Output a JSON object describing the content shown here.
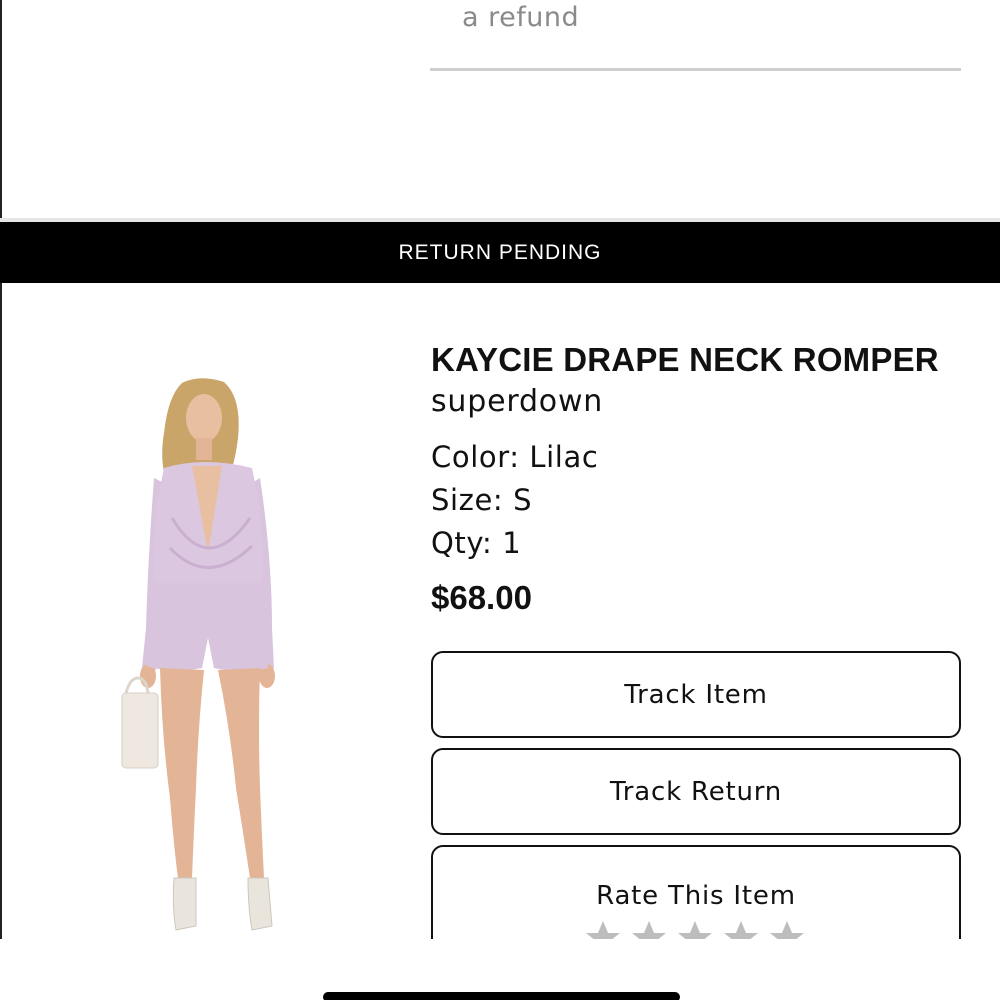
{
  "previous_section": {
    "refund_text": "a refund"
  },
  "status_banner": {
    "label": "RETURN PENDING",
    "background": "#000000",
    "text_color": "#ffffff"
  },
  "item": {
    "title": "KAYCIE DRAPE NECK ROMPER",
    "brand": "superdown",
    "color": "Color: Lilac",
    "size": "Size: S",
    "qty": "Qty: 1",
    "price": "$68.00",
    "image_icon": "product-photo-lilac-romper"
  },
  "actions": {
    "track_item": "Track Item",
    "track_return": "Track Return",
    "rate_item": "Rate This Item",
    "rating": 0,
    "rating_max": 5
  }
}
